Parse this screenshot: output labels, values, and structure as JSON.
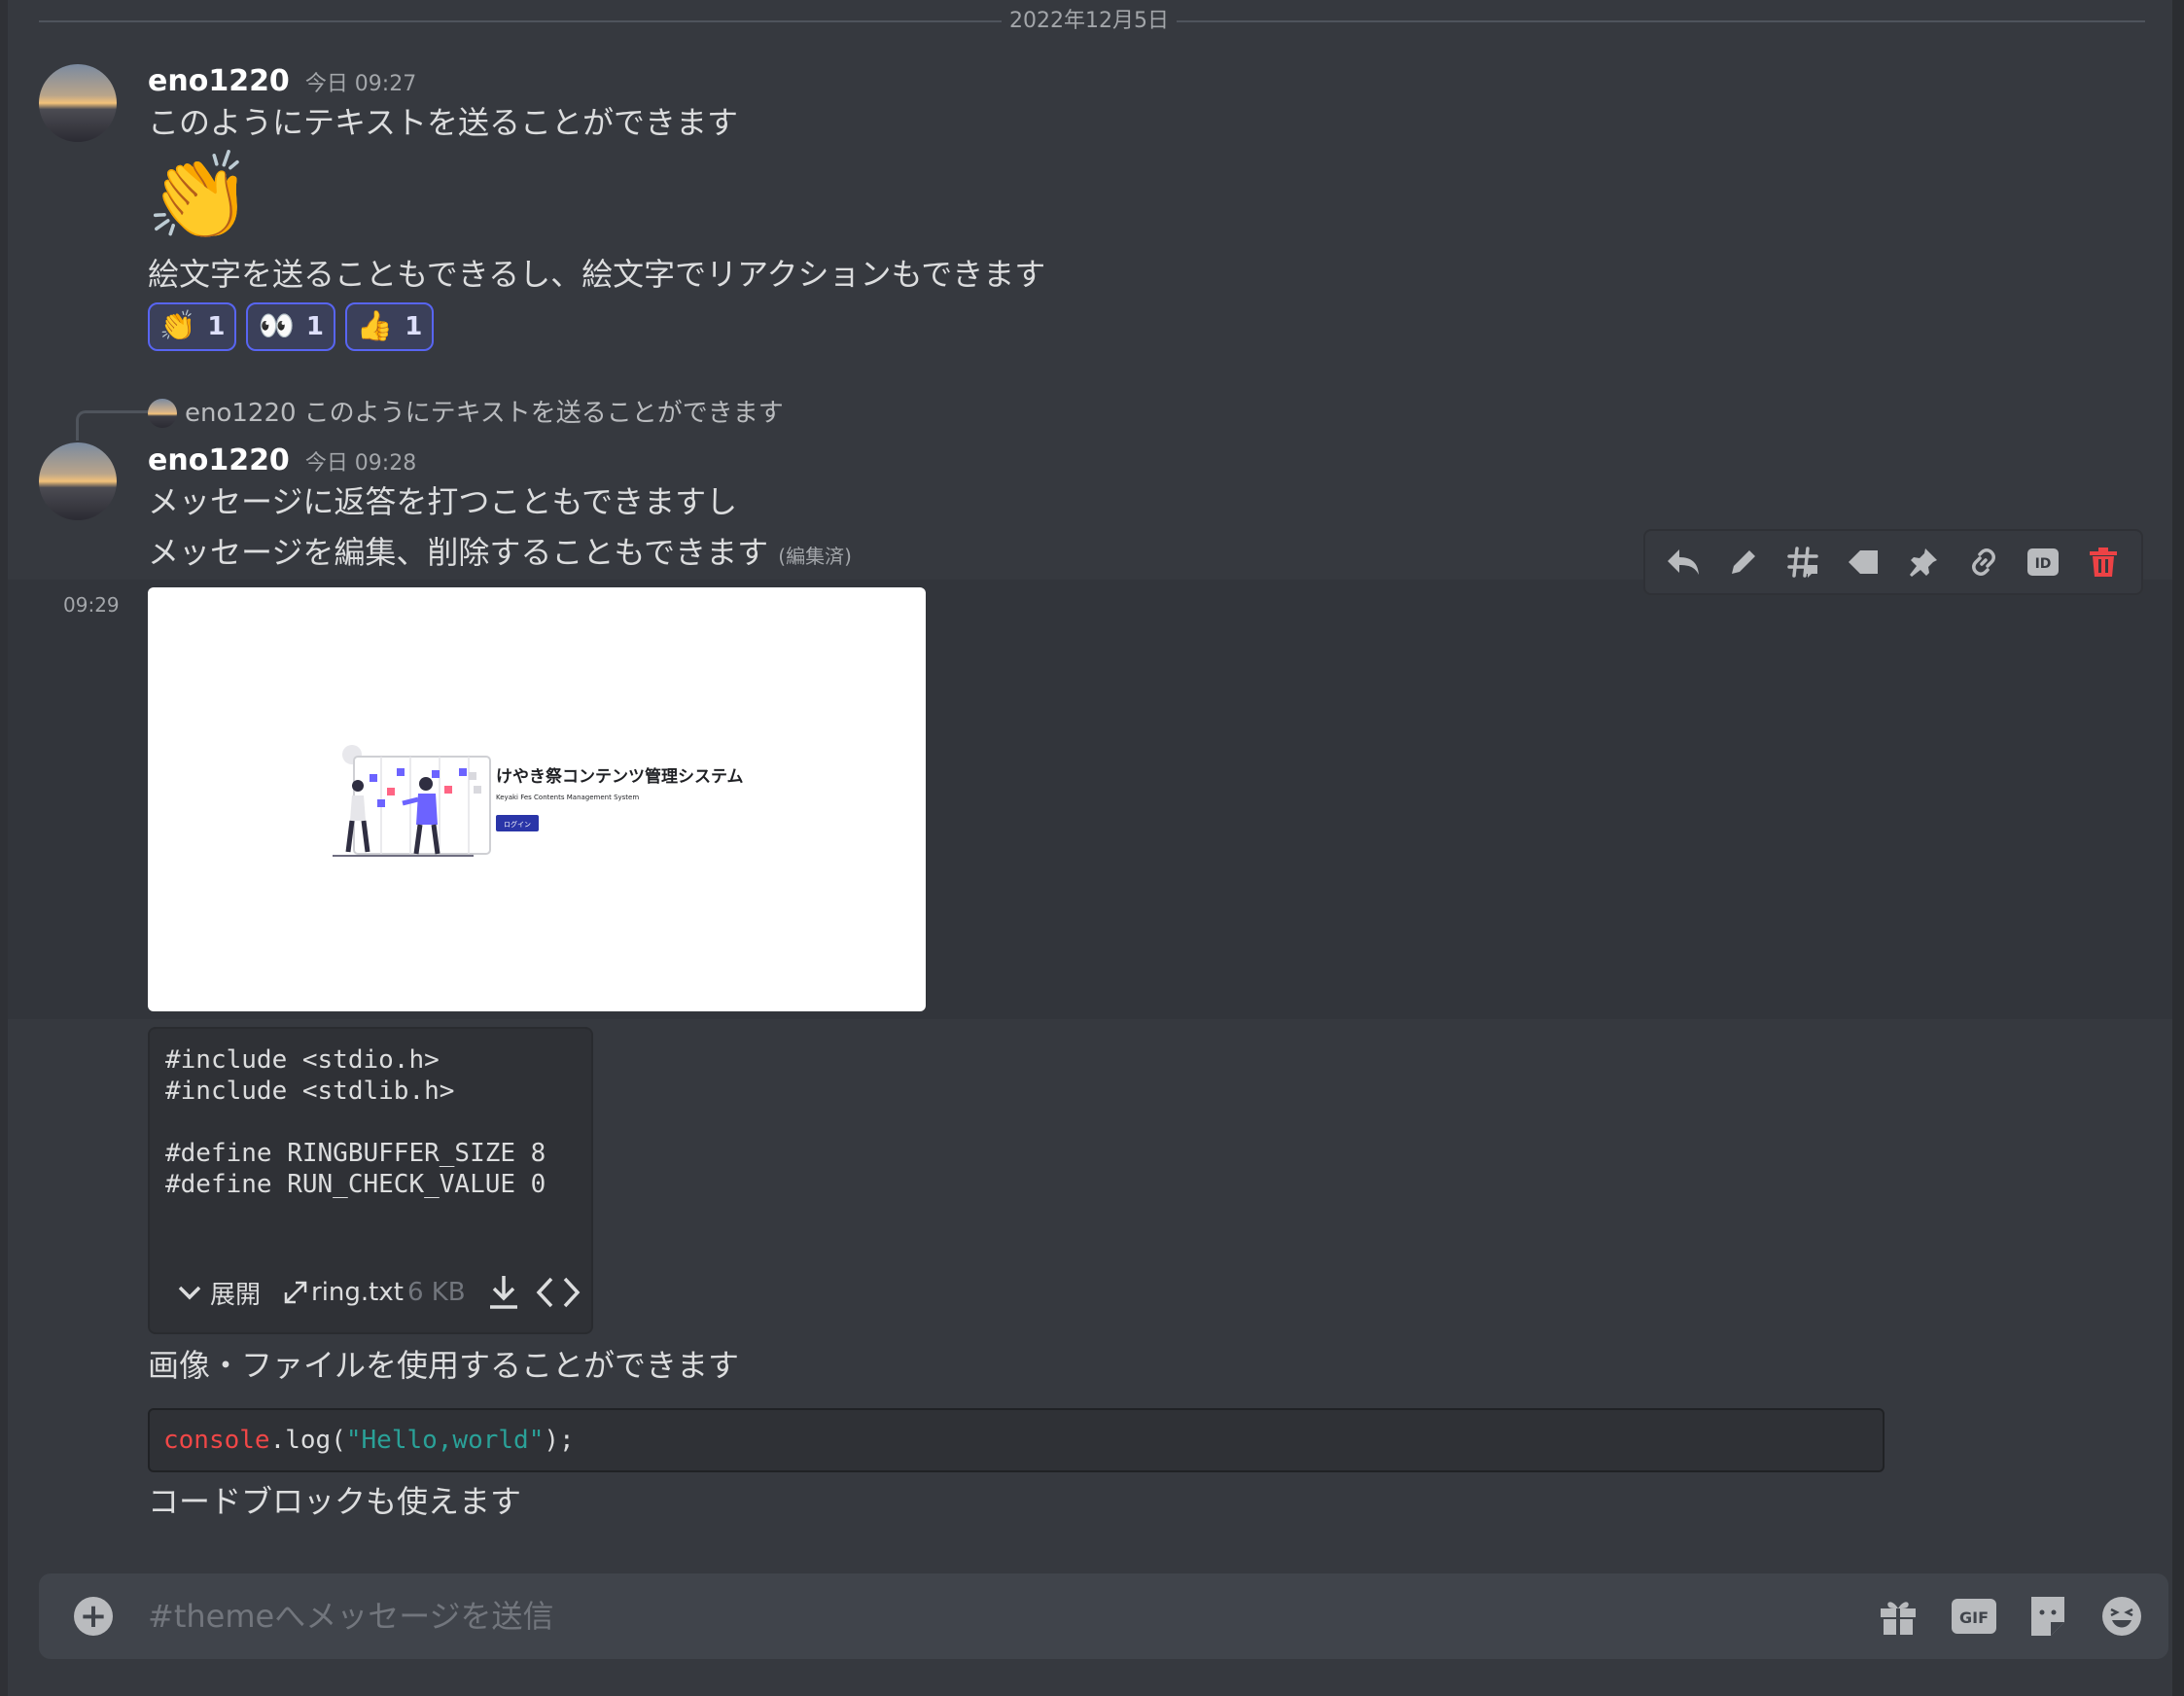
{
  "divider": {
    "date": "2022年12月5日"
  },
  "messages": [
    {
      "username": "eno1220",
      "timestamp": "今日 09:27",
      "text1": "このようにテキストを送ることができます",
      "big_emoji": "👏",
      "text2": "絵文字を送ることもできるし、絵文字でリアクションもできます",
      "reactions": [
        {
          "emoji": "👏",
          "count": "1"
        },
        {
          "emoji": "👀",
          "count": "1"
        },
        {
          "emoji": "👍",
          "count": "1"
        }
      ]
    },
    {
      "reply": {
        "username": "eno1220",
        "text": "このようにテキストを送ることができます"
      },
      "username": "eno1220",
      "timestamp": "今日 09:28",
      "line1": "メッセージに返答を打つこともできますし",
      "line2": "メッセージを編集、削除することもできます",
      "edited": "(編集済)"
    }
  ],
  "followup": {
    "time": "09:29",
    "image": {
      "title": "けやき祭コンテンツ管理システム",
      "subtitle": "Keyaki Fes Contents Management System",
      "button": "ログイン"
    },
    "file": {
      "code_lines": [
        "#include <stdio.h>",
        "#include <stdlib.h>",
        "",
        "#define RINGBUFFER_SIZE 8",
        "#define RUN_CHECK_VALUE 0"
      ],
      "expand_label": "展開",
      "filename": "ring.txt",
      "size": "6 KB"
    },
    "text_after_file": "画像・ファイルを使用することができます",
    "code": {
      "obj": "console",
      "rest1": ".log(",
      "str": "\"Hello,world\"",
      "rest2": ");"
    },
    "text_after_code": "コードブロックも使えます"
  },
  "composer": {
    "placeholder": "#themeへメッセージを送信",
    "gif_label": "GIF"
  },
  "colors": {
    "accent": "#5865f2",
    "danger": "#ed4245",
    "background": "#36393f"
  },
  "icons": [
    "reply-icon",
    "edit-icon",
    "thread-icon",
    "tag-icon",
    "pin-icon",
    "link-icon",
    "id-icon",
    "trash-icon",
    "add-icon",
    "gift-icon",
    "gif-icon",
    "sticker-icon",
    "emoji-icon",
    "download-icon",
    "code-icon",
    "expand-icon",
    "chevron-down-icon"
  ]
}
